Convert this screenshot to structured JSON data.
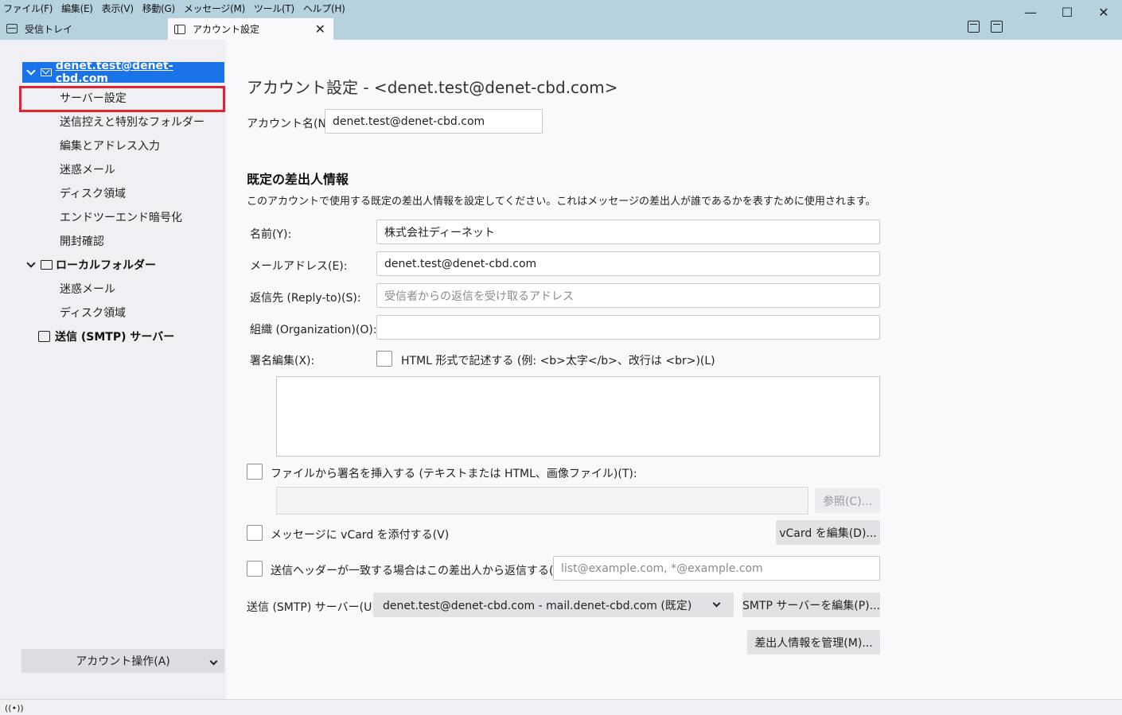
{
  "menu": [
    "ファイル(F)",
    "編集(E)",
    "表示(V)",
    "移動(G)",
    "メッセージ(M)",
    "ツール(T)",
    "ヘルプ(H)"
  ],
  "window_controls": {
    "minimize": "—",
    "maximize": "☐",
    "close": "✕"
  },
  "tabs": [
    {
      "label": "受信トレイ",
      "icon": "inbox-icon"
    },
    {
      "label": "アカウント設定",
      "icon": "settings-tab-icon",
      "close": "✕"
    }
  ],
  "sidebar": {
    "account": "denet.test@denet-cbd.com",
    "account_children": [
      "サーバー設定",
      "送信控えと特別なフォルダー",
      "編集とアドレス入力",
      "迷惑メール",
      "ディスク領域",
      "エンドツーエンド暗号化",
      "開封確認"
    ],
    "local_folders": "ローカルフォルダー",
    "local_children": [
      "迷惑メール",
      "ディスク領域"
    ],
    "smtp": "送信 (SMTP) サーバー",
    "account_actions": "アカウント操作(A)"
  },
  "main": {
    "title": "アカウント設定 - <denet.test@denet-cbd.com>",
    "account_name_label": "アカウント名(N):",
    "account_name_value": "denet.test@denet-cbd.com",
    "section_title": "既定の差出人情報",
    "section_desc": "このアカウントで使用する既定の差出人情報を設定してください。これはメッセージの差出人が誰であるかを表すために使用されます。",
    "name_label": "名前(Y):",
    "name_value": "株式会社ディーネット",
    "email_label": "メールアドレス(E):",
    "email_value": "denet.test@denet-cbd.com",
    "replyto_label": "返信先 (Reply-to)(S):",
    "replyto_placeholder": "受信者からの返信を受け取るアドレス",
    "org_label": "組織 (Organization)(O):",
    "org_value": "",
    "sig_label": "署名編集(X):",
    "html_sig_label": "HTML 形式で記述する (例: <b>太字</b>、改行は <br>)(L)",
    "sig_file_label": "ファイルから署名を挿入する (テキストまたは HTML、画像ファイル)(T):",
    "browse_btn": "参照(C)...",
    "vcard_label": "メッセージに vCard を添付する(V)",
    "vcard_btn": "vCard を編集(D)...",
    "reply_header_label": "送信ヘッダーが一致する場合はこの差出人から返信する(D):",
    "reply_header_placeholder": "list@example.com, *@example.com",
    "smtp_label": "送信 (SMTP) サーバー(U):",
    "smtp_value": "denet.test@denet-cbd.com - mail.denet-cbd.com (既定)",
    "smtp_btn": "SMTP サーバーを編集(P)...",
    "manage_btn": "差出人情報を管理(M)..."
  },
  "colors": {
    "accent": "#1a73e8",
    "titlebar": "#b7d2df",
    "highlight_box": "#e0232e"
  }
}
